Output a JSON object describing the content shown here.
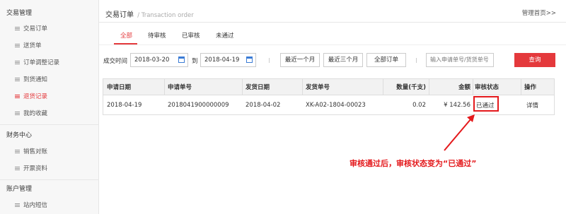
{
  "sidebar": {
    "groups": [
      {
        "title": "交易管理",
        "items": [
          "交易订单",
          "送货单",
          "订单调整记录",
          "到货通知",
          "退货记录",
          "我的收藏"
        ]
      },
      {
        "title": "财务中心",
        "items": [
          "销售对账",
          "开票资料"
        ]
      },
      {
        "title": "账户管理",
        "items": [
          "站内短信"
        ]
      }
    ],
    "active_item": "退货记录"
  },
  "header": {
    "title": "交易订单",
    "subtitle": "/ Transaction order",
    "home_link": "管理首页>>"
  },
  "tabs": [
    "全部",
    "待审核",
    "已审核",
    "未通过"
  ],
  "active_tab": "全部",
  "filter": {
    "date_label": "成交时间",
    "start_date": "2018-03-20",
    "to_label": "到",
    "end_date": "2018-04-19",
    "btn_month": "最近一个月",
    "btn_three_months": "最近三个月",
    "btn_all": "全部订单",
    "search_placeholder": "输入申请单号/货货单号",
    "query_label": "查询"
  },
  "table": {
    "headers": [
      "申请日期",
      "申请单号",
      "发货日期",
      "发货单号",
      "数量(千支)",
      "金额",
      "审核状态",
      "操作"
    ],
    "rows": [
      [
        "2018-04-19",
        "2018041900000009",
        "2018-04-02",
        "XK-A02-1804-00023",
        "0.02",
        "¥ 142.56",
        "已通过",
        "详情"
      ]
    ]
  },
  "annotation": "审核通过后，审核状态变为“已通过”",
  "colors": {
    "accent": "#e4393c",
    "annotation": "#e4191c"
  }
}
